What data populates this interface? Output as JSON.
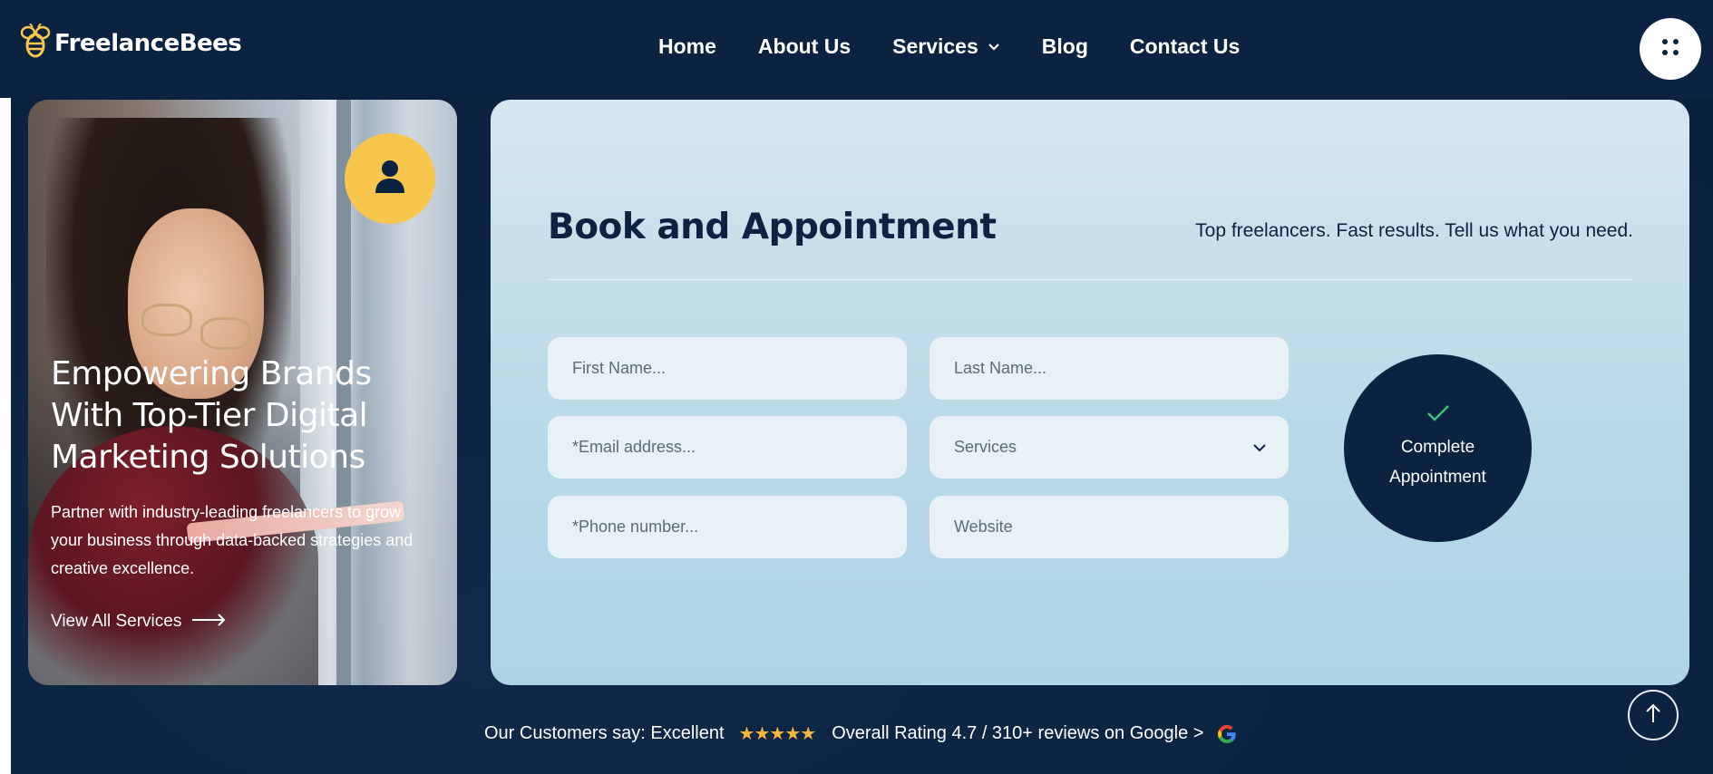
{
  "brand": {
    "name": "FreelanceBees",
    "accent": "#f8c54d",
    "dark": "#0b2340"
  },
  "nav": {
    "items": [
      {
        "label": "Home"
      },
      {
        "label": "About Us"
      },
      {
        "label": "Services"
      },
      {
        "label": "Blog"
      },
      {
        "label": "Contact Us"
      }
    ]
  },
  "hero": {
    "title": "Empowering Brands With Top-Tier Digital Marketing Solutions",
    "description": "Partner with industry-leading freelancers to grow your business through data-backed strategies and creative excellence.",
    "link_label": "View All Services",
    "avatar_icon": "user-icon"
  },
  "form": {
    "title": "Book and Appointment",
    "tagline": "Top freelancers. Fast results. Tell us what you need.",
    "fields": {
      "first_name": "First Name...",
      "last_name": "Last Name...",
      "email": "*Email address...",
      "services": "Services",
      "phone": "*Phone number...",
      "website": "Website"
    },
    "submit": {
      "line1": "Complete",
      "line2": "Appointment",
      "icon": "check-icon",
      "icon_color": "#3cc47c"
    }
  },
  "reviews": {
    "prefix": "Our Customers say: Excellent",
    "stars": "★★★★★",
    "rating_text": "Overall Rating 4.7 / 310+ reviews on Google >",
    "rating": 4.7,
    "icon": "google-icon"
  },
  "scroll_top_icon": "arrow-up-icon"
}
